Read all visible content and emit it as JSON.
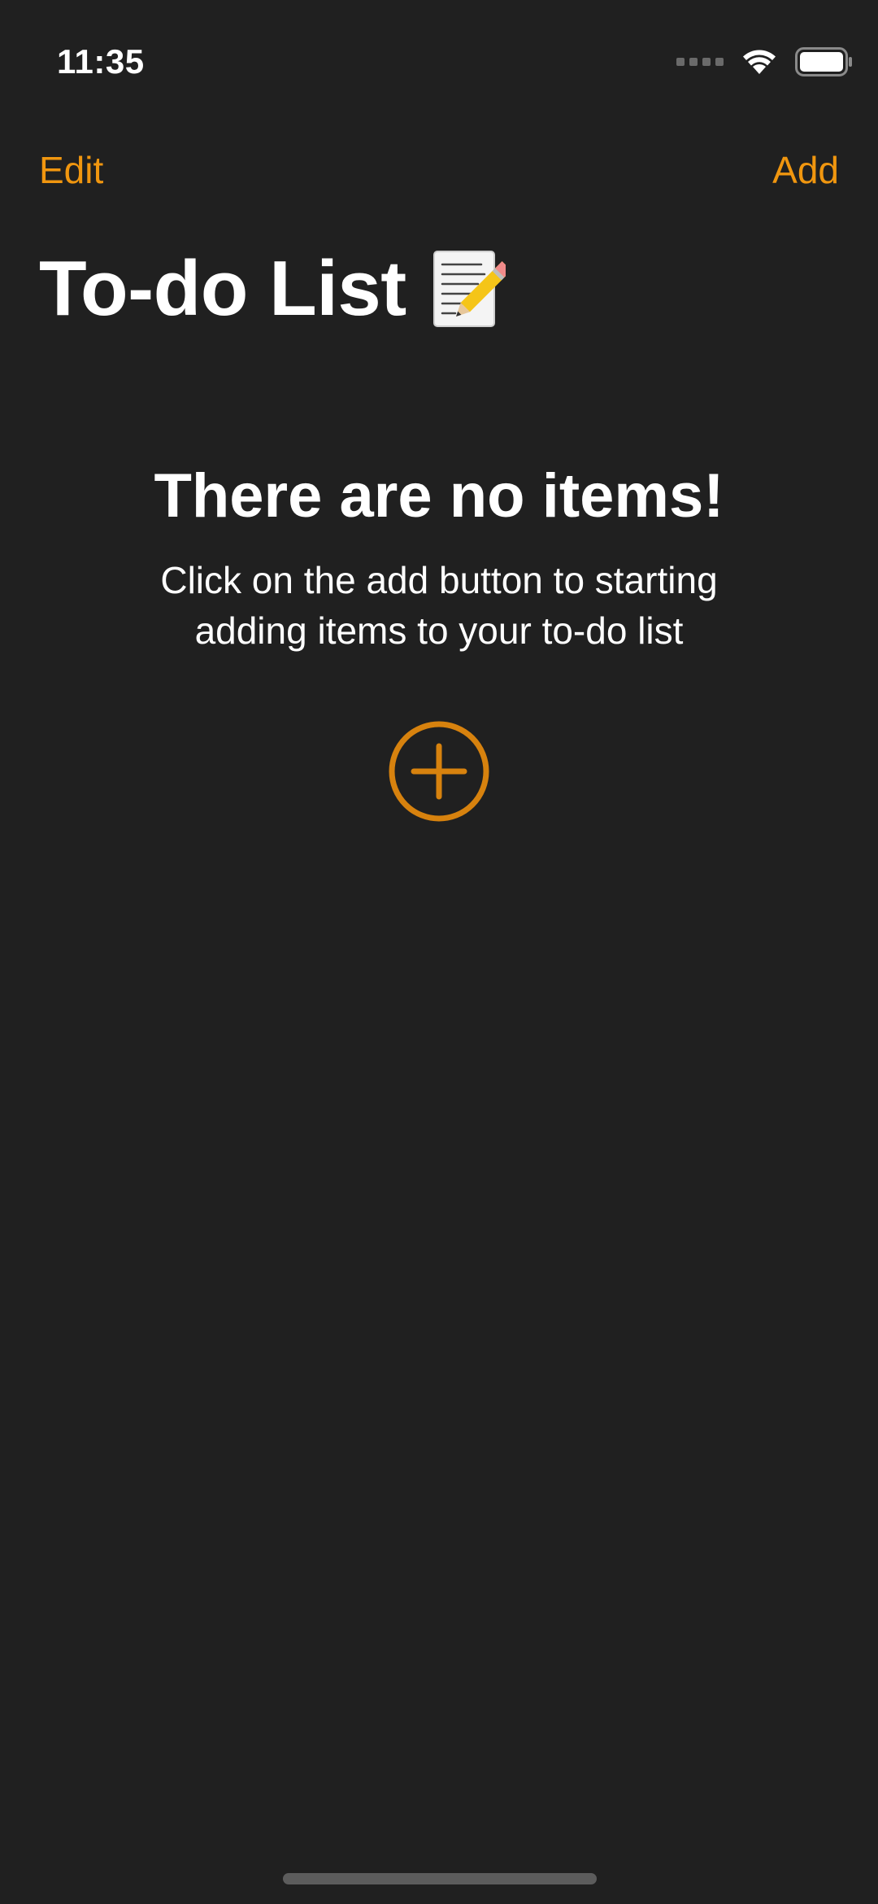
{
  "status_bar": {
    "time": "11:35",
    "icons": [
      "cellular-signal-icon",
      "wifi-icon",
      "battery-icon"
    ]
  },
  "nav": {
    "edit_label": "Edit",
    "add_label": "Add"
  },
  "title": {
    "text": "To-do List",
    "icon": "memo-icon"
  },
  "empty_state": {
    "title": "There are no items!",
    "description": "Click on the add button to starting adding items to your to-do list",
    "button_icon": "plus-circle-icon"
  },
  "colors": {
    "background": "#202020",
    "accent": "#f0960f",
    "text": "#ffffff"
  }
}
